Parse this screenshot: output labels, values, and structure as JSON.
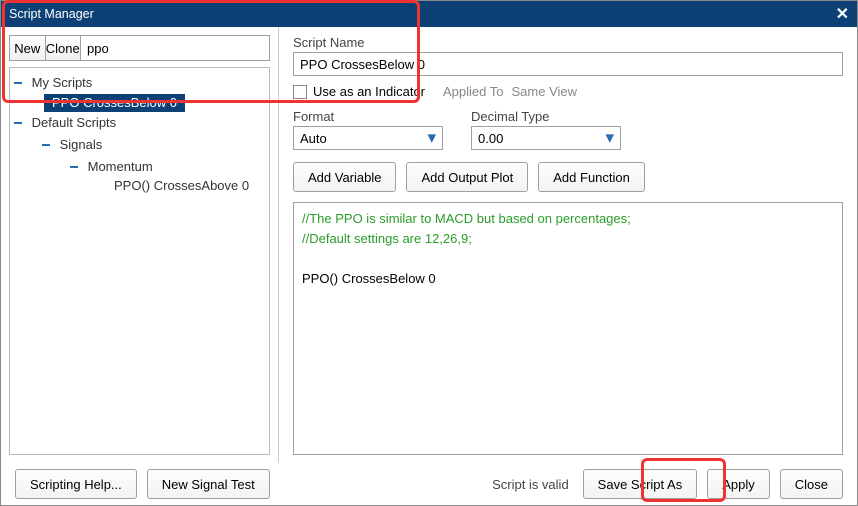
{
  "window": {
    "title": "Script Manager",
    "close_icon": "✕"
  },
  "left": {
    "new_label": "New",
    "clone_label": "Clone",
    "search_value": "ppo",
    "tree": {
      "my_scripts": "My Scripts",
      "selected": "PPO CrossesBelow 0",
      "default_scripts": "Default Scripts",
      "signals": "Signals",
      "momentum": "Momentum",
      "ppo_above": "PPO() CrossesAbove 0"
    }
  },
  "right": {
    "name_label": "Script Name",
    "name_value": "PPO CrossesBelow 0",
    "indicator_label": "Use as an Indicator",
    "applied_to": "Applied To",
    "same_view": "Same View",
    "format_label": "Format",
    "decimal_label": "Decimal Type",
    "format_value": "Auto",
    "decimal_value": "0.00",
    "add_var": "Add Variable",
    "add_plot": "Add Output Plot",
    "add_func": "Add Function",
    "editor_comment1": "//The PPO is similar to MACD but based on percentages;",
    "editor_comment2": "//Default settings are 12,26,9;",
    "editor_body": "PPO() CrossesBelow 0"
  },
  "footer": {
    "help": "Scripting Help...",
    "test": "New Signal Test",
    "valid": "Script is valid",
    "save_as": "Save Script As",
    "apply": "Apply",
    "close": "Close"
  }
}
